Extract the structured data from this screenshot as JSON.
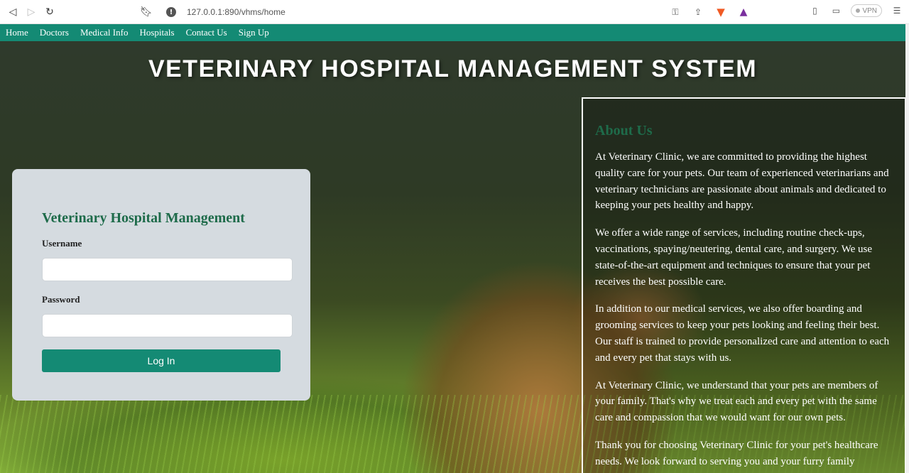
{
  "browser": {
    "url": "127.0.0.1:890/vhms/home",
    "vpn_label": "VPN"
  },
  "nav": [
    "Home",
    "Doctors",
    "Medical Info",
    "Hospitals",
    "Contact Us",
    "Sign Up"
  ],
  "hero": {
    "title": "VETERINARY HOSPITAL MANAGEMENT SYSTEM"
  },
  "login": {
    "title": "Veterinary Hospital Management",
    "username_label": "Username",
    "password_label": "Password",
    "button_label": "Log In"
  },
  "about": {
    "title": "About Us",
    "paragraphs": [
      "At Veterinary Clinic, we are committed to providing the highest quality care for your pets. Our team of experienced veterinarians and veterinary technicians are passionate about animals and dedicated to keeping your pets healthy and happy.",
      "We offer a wide range of services, including routine check-ups, vaccinations, spaying/neutering, dental care, and surgery. We use state-of-the-art equipment and techniques to ensure that your pet receives the best possible care.",
      "In addition to our medical services, we also offer boarding and grooming services to keep your pets looking and feeling their best. Our staff is trained to provide personalized care and attention to each and every pet that stays with us.",
      "At Veterinary Clinic, we understand that your pets are members of your family. That's why we treat each and every pet with the same care and compassion that we would want for our own pets.",
      "Thank you for choosing Veterinary Clinic for your pet's healthcare needs. We look forward to serving you and your furry family"
    ]
  }
}
